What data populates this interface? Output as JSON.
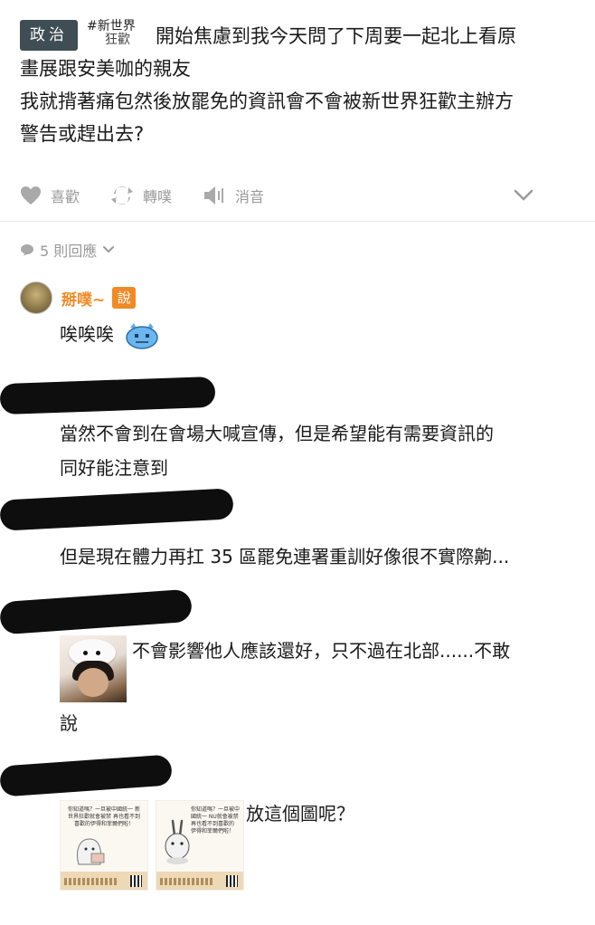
{
  "post": {
    "category_badge": "政治",
    "tag_line1": "#新世界",
    "tag_line2": "狂歡",
    "text_line1": "開始焦慮到我今天問了下周要一起北上看原",
    "text_line2": "畫展跟安美咖的親友",
    "text_line3": "我就揹著痛包然後放罷免的資訊會不會被新世界狂歡主辦方",
    "text_line4": "警告或趕出去?"
  },
  "actions": {
    "like": "喜歡",
    "repost": "轉噗",
    "mute": "消音"
  },
  "replies": {
    "count_label": "5 則回應"
  },
  "comments": [
    {
      "author": "掰噗~",
      "badge": "說",
      "text": "唉唉唉"
    },
    {
      "text_line1": "當然不會到在會場大喊宣傳，但是希望能有需要資訊的",
      "text_line2": "同好能注意到"
    },
    {
      "text": "但是現在體力再扛 35 區罷免連署重訓好像很不實際齁..."
    },
    {
      "text_line1": "不會影響他人應該還好，只不過在北部......不敢",
      "text_line2": "說"
    },
    {
      "text": "放這個圖呢？",
      "card1_text": "你知道嗎？一旦被中國統一 新世界狂歡就會被禁 再也看不到喜歡的伊得和菲爾們啦！",
      "card2_text": "你知道嗎？一旦被中國統一 NU就會被禁 再也看不到喜歡的 伊得和菲爾們啦！"
    }
  ],
  "colors": {
    "accent_orange": "#f08a26",
    "muted_gray": "#9a9a9a",
    "badge_dark": "#3f4d55"
  }
}
